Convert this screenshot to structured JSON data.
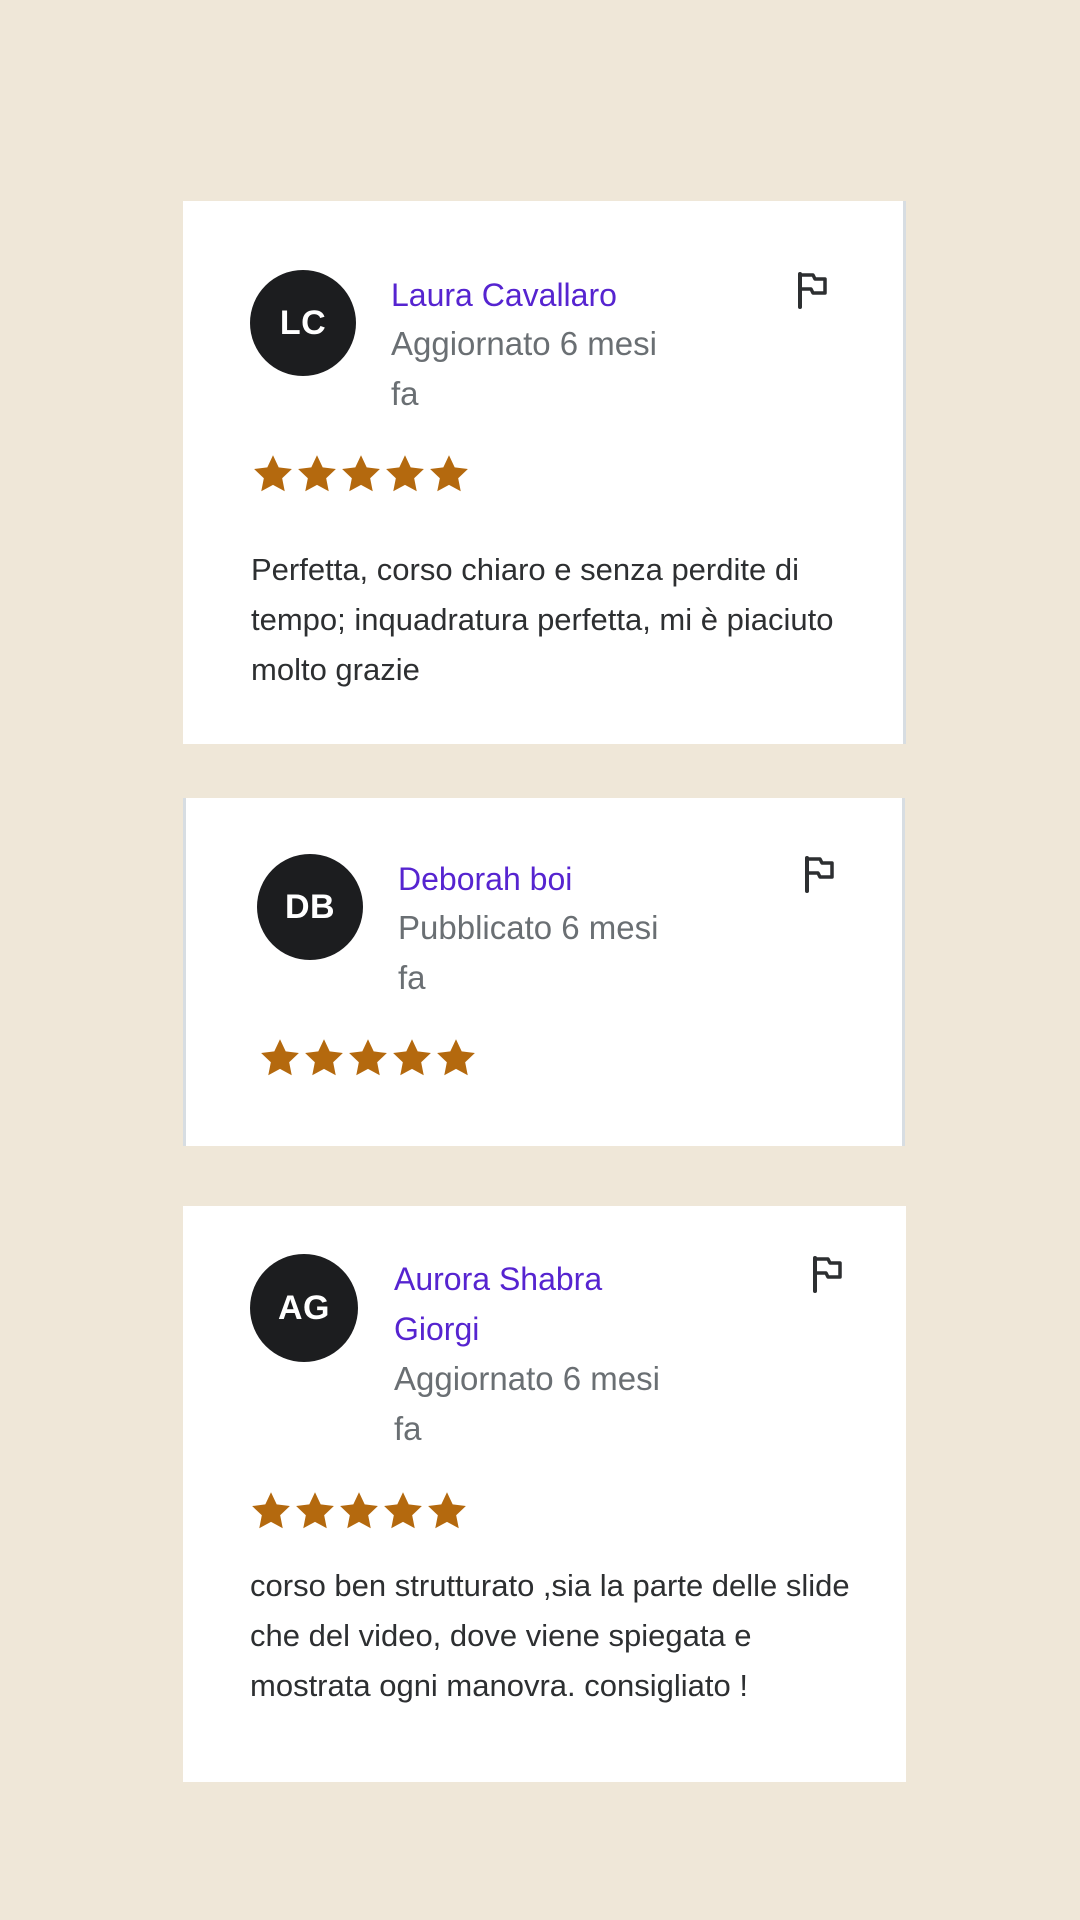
{
  "colors": {
    "background": "#efe7d8",
    "card": "#ffffff",
    "name": "#5624d0",
    "meta": "#6a6f73",
    "star": "#b4690e",
    "avatar": "#1c1d1f"
  },
  "reviews": [
    {
      "initials": "LC",
      "name": "Laura Cavallaro",
      "meta_line1": "Aggiornato 6 mesi",
      "meta_line2": "fa",
      "rating": 5,
      "text": "Perfetta, corso chiaro e senza perdite di tempo; inquadratura perfetta, mi è piaciuto molto grazie",
      "flag_icon": "flag-icon"
    },
    {
      "initials": "DB",
      "name": "Deborah boi",
      "meta_line1": "Pubblicato 6 mesi",
      "meta_line2": "fa",
      "rating": 5,
      "text": "",
      "flag_icon": "flag-icon"
    },
    {
      "initials": "AG",
      "name": "Aurora Shabra Giorgi",
      "meta_line1": "Aggiornato 6 mesi",
      "meta_line2": "fa",
      "rating": 5,
      "text": "corso ben strutturato ,sia la parte delle slide che del video, dove viene spiegata e mostrata ogni manovra. consigliato !",
      "flag_icon": "flag-icon"
    }
  ]
}
